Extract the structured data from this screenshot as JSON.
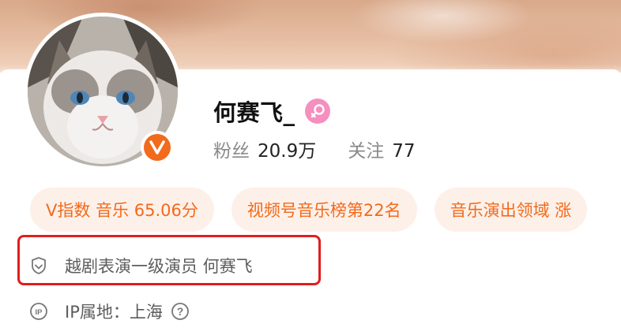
{
  "profile": {
    "username": "何赛飞_",
    "gender_icon": "female-icon",
    "verified_icon": "verified-v-icon",
    "avatar_icon": "cat-avatar"
  },
  "stats": {
    "fans_label": "粉丝",
    "fans_value": "20.9万",
    "following_label": "关注",
    "following_value": "77"
  },
  "tags": [
    {
      "label": "V指数 音乐 65.06分"
    },
    {
      "label": "视频号音乐榜第22名"
    },
    {
      "label": "音乐演出领域 涨"
    }
  ],
  "info": {
    "certification": "越剧表演一级演员 何赛飞",
    "certification_icon": "shield-icon",
    "ip_location": "IP属地：上海",
    "ip_icon": "ip-icon",
    "help_icon": "question-icon"
  },
  "colors": {
    "accent": "#f26a1b",
    "tag_bg": "#fdf0e9",
    "gender_pink": "#f58fbf",
    "highlight": "#e21d1d"
  }
}
